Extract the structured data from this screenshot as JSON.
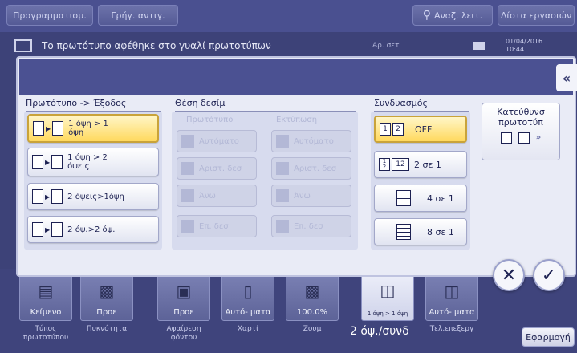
{
  "topbar": {
    "programs_label": "Προγραμματισμ.",
    "copy_label": "Γρήγ. αντιγ.",
    "search_label": "Αναζ. λειτ.",
    "joblist_label": "Λίστα εργασιών"
  },
  "message": {
    "text": "Το πρωτότυπο αφέθηκε στο γυαλί πρωτοτύπων",
    "paper": "Αρ. σετ",
    "datetime": "01/04/2016 10:44"
  },
  "dialog": {
    "original_output": {
      "title": "Πρωτότυπο -> Έξοδος",
      "options": [
        {
          "label": "1 όψη > 1 όψη",
          "selected": true
        },
        {
          "label": "1 όψη > 2 όψεις",
          "selected": false
        },
        {
          "label": "2 όψεις>1όψη",
          "selected": false
        },
        {
          "label": "2 όψ.>2 όψ.",
          "selected": false
        }
      ]
    },
    "binding": {
      "title": "Θέση δεσίμ",
      "original_header": "Πρωτότυπο",
      "output_header": "Εκτύπωση",
      "original_options": [
        "Αυτόματο",
        "Αριστ. δεσ",
        "Άνω",
        "Επ. δεσ"
      ],
      "output_options": [
        "Αυτόματο",
        "Αριστ. δεσ",
        "Άνω",
        "Επ. δεσ"
      ]
    },
    "combine": {
      "title": "Συνδυασμός",
      "options": [
        {
          "label": "OFF",
          "selected": true
        },
        {
          "label": "2 σε 1",
          "selected": false
        },
        {
          "label": "4 σε 1",
          "selected": false
        },
        {
          "label": "8 σε 1",
          "selected": false
        }
      ]
    },
    "direction": {
      "label": "Κατεύθυνσ πρωτοτύπ"
    }
  },
  "bottom": {
    "tiles": [
      {
        "label": "Κείμενο",
        "caption": "Τύπος πρωτοτύπου"
      },
      {
        "label": "Προε",
        "caption": "Πυκνότητα"
      },
      {
        "label": "Προε",
        "caption": "Αφαίρεση φόντου"
      },
      {
        "label": "Αυτό- ματα",
        "caption": "Χαρτί"
      },
      {
        "label": "100.0%",
        "caption": "Ζουμ"
      },
      {
        "label": "1 όψη > 1 όψη",
        "caption": "2 όψ./συνδ"
      },
      {
        "label": "Αυτό- ματα",
        "caption": "Τελ.επεξεργ"
      }
    ],
    "apply_label": "Εφαρμογή"
  },
  "colors": {
    "accent": "#4b5192",
    "selected": "#ffd95e"
  }
}
